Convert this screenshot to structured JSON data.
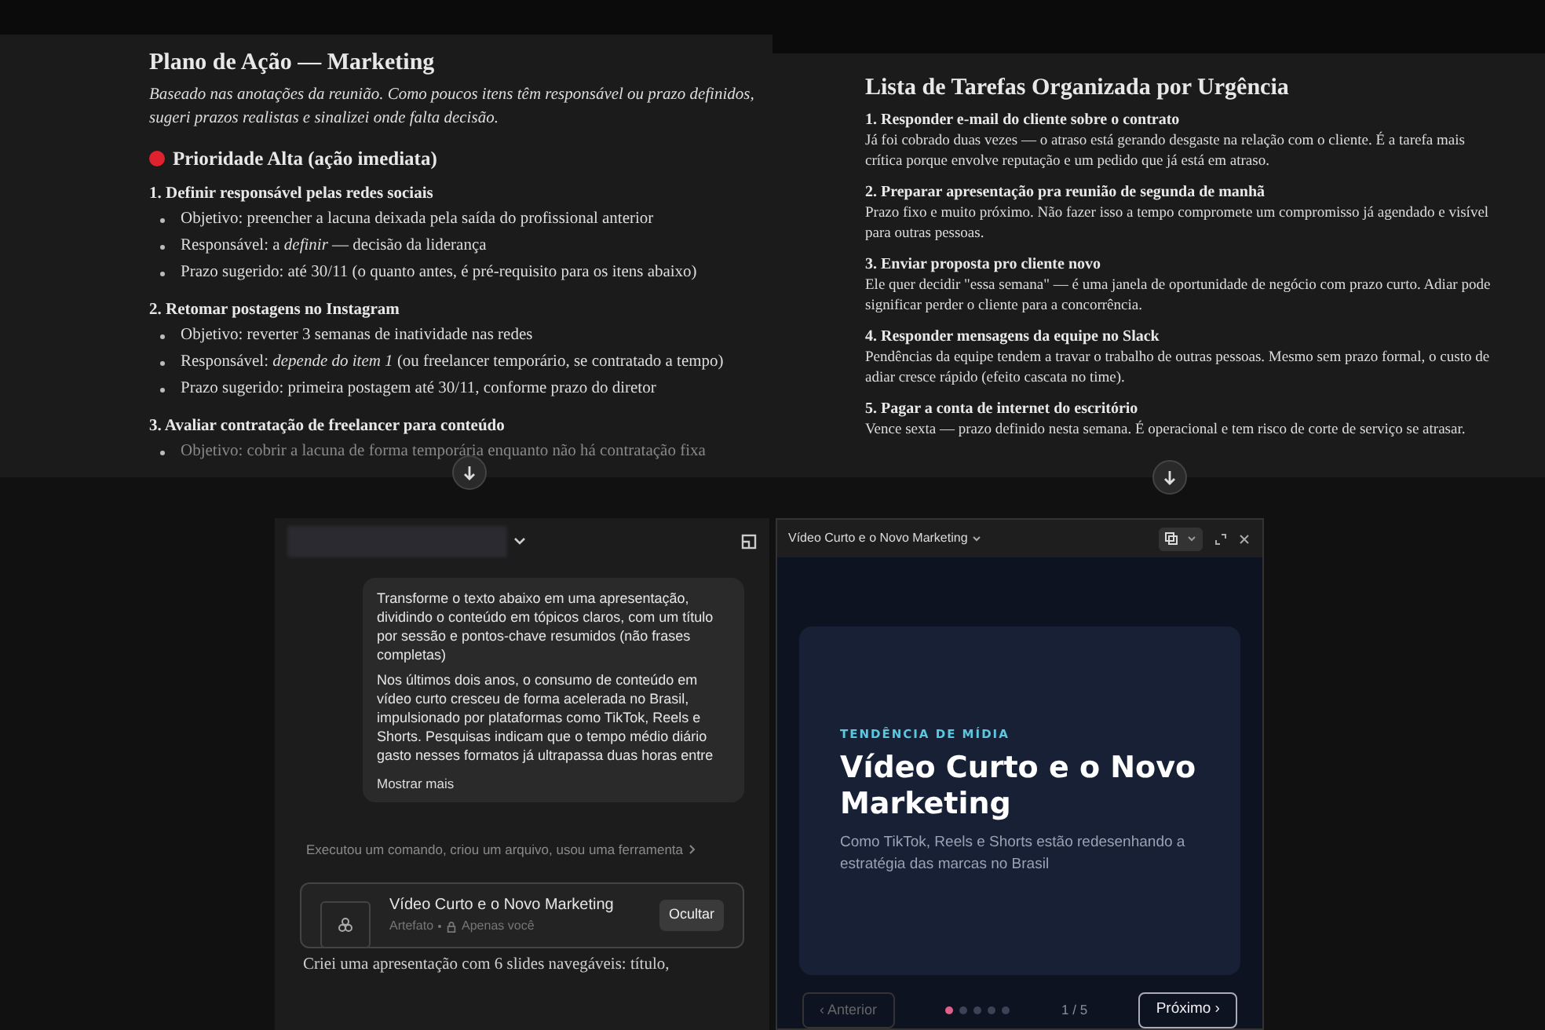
{
  "action_plan": {
    "title": "Plano de Ação — Marketing",
    "intro": "Baseado nas anotações da reunião. Como poucos itens têm responsável ou prazo definidos, sugeri prazos realistas e sinalizei onde falta decisão.",
    "priority": {
      "label": "Prioridade Alta (ação imediata)",
      "color": "#e0222e"
    },
    "tasks": [
      {
        "heading": "1. Definir responsável pelas redes sociais",
        "bullets": [
          "Objetivo: preencher a lacuna deixada pela saída do profissional anterior",
          "Responsável: a *definir* — decisão da liderança",
          "Prazo sugerido: até 30/11 (o quanto antes, é pré-requisito para os itens abaixo)"
        ]
      },
      {
        "heading": "2. Retomar postagens no Instagram",
        "bullets": [
          "Objetivo: reverter 3 semanas de inatividade nas redes",
          "Responsável: *depende do item 1* (ou freelancer temporário, se contratado a tempo)",
          "Prazo sugerido: primeira postagem até 30/11, conforme prazo do diretor"
        ]
      },
      {
        "heading": "3. Avaliar contratação de freelancer para conteúdo",
        "bullets": [
          "Objetivo: cobrir a lacuna de forma temporária enquanto não há contratação fixa"
        ]
      }
    ]
  },
  "task_list": {
    "title": "Lista de Tarefas Organizada por Urgência",
    "items": [
      {
        "heading": "1. Responder e-mail do cliente sobre o contrato",
        "text": "Já foi cobrado duas vezes — o atraso está gerando desgaste na relação com o cliente. É a tarefa mais crítica porque envolve reputação e um pedido que já está em atraso."
      },
      {
        "heading": "2. Preparar apresentação pra reunião de segunda de manhã",
        "text": "Prazo fixo e muito próximo. Não fazer isso a tempo compromete um compromisso já agendado e visível para outras pessoas."
      },
      {
        "heading": "3. Enviar proposta pro cliente novo",
        "text": "Ele quer decidir \"essa semana\" — é uma janela de oportunidade de negócio com prazo curto. Adiar pode significar perder o cliente para a concorrência."
      },
      {
        "heading": "4. Responder mensagens da equipe no Slack",
        "text": "Pendências da equipe tendem a travar o trabalho de outras pessoas. Mesmo sem prazo formal, o custo de adiar cresce rápido (efeito cascata no time)."
      },
      {
        "heading": "5. Pagar a conta de internet do escritório",
        "text": "Vence sexta — prazo definido nesta semana. É operacional e tem risco de corte de serviço se atrasar."
      }
    ]
  },
  "chat": {
    "message": {
      "paragraphs": [
        "Transforme o texto abaixo em uma apresentação, dividindo o conteúdo em tópicos claros, com um título por sessão e pontos-chave resumidos (não frases completas)",
        "Nos últimos dois anos, o consumo de conteúdo em vídeo curto cresceu de forma acelerada no Brasil, impulsionado por plataformas como TikTok, Reels e Shorts. Pesquisas indicam que o tempo médio diário gasto nesses formatos já ultrapassa duas horas entre"
      ],
      "show_more": "Mostrar mais"
    },
    "activity": "Executou um comando, criou um arquivo, usou uma ferramenta",
    "artifact": {
      "title": "Vídeo Curto e o Novo Marketing",
      "meta": "Artefato",
      "visibility": "Apenas você",
      "button": "Ocultar"
    },
    "reply": "Criei uma apresentação com 6 slides navegáveis: título,"
  },
  "preview": {
    "title": "Vídeo Curto e o Novo Marketing",
    "slide": {
      "eyebrow": "TENDÊNCIA DE MÍDIA",
      "title": "Vídeo Curto e o Novo Marketing",
      "subtitle": "Como TikTok, Reels e Shorts estão redesenhando a estratégia das marcas no Brasil"
    },
    "prev": {
      "label": "‹ Anterior",
      "disabled": true
    },
    "dots": [
      {
        "selected": true
      },
      {
        "selected": false
      },
      {
        "selected": false
      },
      {
        "selected": false
      },
      {
        "selected": false
      }
    ],
    "counter": "1 / 5",
    "next": {
      "label": "Próximo ›",
      "disabled": false
    }
  }
}
